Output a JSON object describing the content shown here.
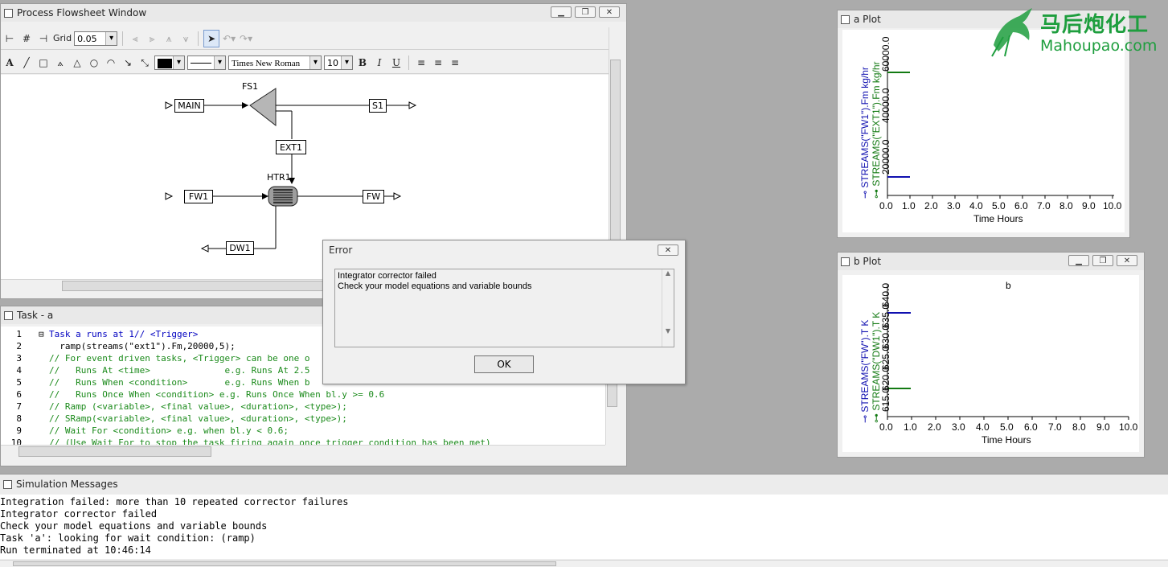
{
  "flowsheet": {
    "title": "Process Flowsheet Window",
    "grid_label": "Grid",
    "grid_value": "0.05",
    "font_name": "Times New Roman",
    "font_size": "10",
    "bold_label": "B",
    "italic_label": "I",
    "underline_label": "U",
    "text_tool_label": "A",
    "blocks": {
      "fs1": "FS1",
      "htr1": "HTR1"
    },
    "streams": {
      "main": "MAIN",
      "s1": "S1",
      "ext1": "EXT1",
      "fw1": "FW1",
      "fw": "FW",
      "dw1": "DW1"
    }
  },
  "task": {
    "title": "Task - a",
    "lines": [
      {
        "n": "1",
        "text": "Task a runs at 1// <Trigger>"
      },
      {
        "n": "2",
        "text": "  ramp(streams(\"ext1\").Fm,20000,5);"
      },
      {
        "n": "3",
        "text": "// For event driven tasks, <Trigger> can be one o"
      },
      {
        "n": "4",
        "text": "//   Runs At <time>              e.g. Runs At 2.5"
      },
      {
        "n": "5",
        "text": "//   Runs When <condition>       e.g. Runs When b"
      },
      {
        "n": "6",
        "text": "//   Runs Once When <condition> e.g. Runs Once When bl.y >= 0.6"
      },
      {
        "n": "7",
        "text": "// Ramp (<variable>, <final value>, <duration>, <type>);"
      },
      {
        "n": "8",
        "text": "// SRamp(<variable>, <final value>, <duration>, <type>);"
      },
      {
        "n": "9",
        "text": "// Wait For <condition> e.g. when bl.y < 0.6;"
      },
      {
        "n": "10",
        "text": "// (Use Wait For to stop the task firing again once trigger condition has been met)"
      }
    ]
  },
  "error_dialog": {
    "title": "Error",
    "message_line1": "Integrator corrector failed",
    "message_line2": "Check your model equations and variable bounds",
    "ok_label": "OK"
  },
  "messages": {
    "title": "Simulation Messages",
    "lines": [
      "Integration failed: more than 10 repeated corrector failures",
      "Integrator corrector failed",
      "Check your model equations and variable bounds",
      "Task 'a': looking for wait condition: (ramp)",
      "Run terminated at 10:46:14"
    ]
  },
  "plot_a": {
    "title": "a Plot",
    "xlabel": "Time Hours",
    "series1_label": "STREAMS(\"FW1\").Fm kg/hr",
    "series2_label": "STREAMS(\"EXT1\").Fm kg/hr",
    "series1_color": "#1010b0",
    "series2_color": "#137a13",
    "x_ticks": [
      "0.0",
      "1.0",
      "2.0",
      "3.0",
      "4.0",
      "5.0",
      "6.0",
      "7.0",
      "8.0",
      "9.0",
      "10.0"
    ],
    "y_ticks": [
      "20000.0",
      "40000.0",
      "60000.0"
    ]
  },
  "plot_b": {
    "title": "b Plot",
    "chart_title": "b",
    "xlabel": "Time Hours",
    "series1_label": "STREAMS(\"FW\").T K",
    "series2_label": "STREAMS(\"DW1\").T K",
    "series1_color": "#1010b0",
    "series2_color": "#137a13",
    "x_ticks": [
      "0.0",
      "1.0",
      "2.0",
      "3.0",
      "4.0",
      "5.0",
      "6.0",
      "7.0",
      "8.0",
      "9.0",
      "10.0"
    ],
    "y_ticks": [
      "615.0",
      "620.0",
      "625.0",
      "630.0",
      "635.0",
      "640.0"
    ]
  },
  "watermark": {
    "cn": "马后炮化工",
    "en": "Mahoupao.com"
  }
}
